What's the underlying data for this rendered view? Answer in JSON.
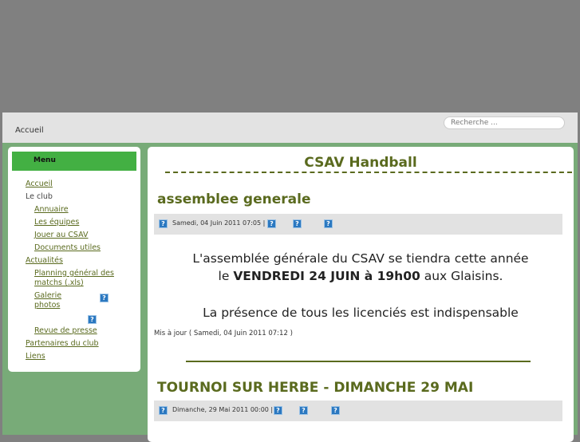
{
  "header": {
    "home": "Accueil",
    "search_placeholder": "Recherche ..."
  },
  "menu": {
    "title": "Menu",
    "items": [
      {
        "label": "Accueil"
      },
      {
        "label": "Le club"
      },
      {
        "label": "Annuaire"
      },
      {
        "label": "Les équipes"
      },
      {
        "label": "Jouer au CSAV"
      },
      {
        "label": "Documents utiles"
      },
      {
        "label": "Actualités"
      },
      {
        "label": "Planning général des matchs (.xls)"
      },
      {
        "label": "Galerie photos"
      },
      {
        "label": "Revue de presse"
      },
      {
        "label": "Partenaires du club"
      },
      {
        "label": "Liens"
      }
    ]
  },
  "main": {
    "site_title": "CSAV Handball",
    "articles": [
      {
        "title": "assemblee generale",
        "date": "Samedi, 04 Juin 2011 07:05 |",
        "line1": "L'assemblée générale du CSAV se tiendra cette année",
        "line2_pre": "le ",
        "line2_bold": "VENDREDI 24 JUIN à 19h00",
        "line2_post": " aux Glaisins.",
        "line3": "La présence de tous les licenciés est indispensable",
        "updated": "Mis à jour ( Samedi, 04 Juin 2011 07:12 )"
      },
      {
        "title": "TOURNOI SUR HERBE - DIMANCHE 29 MAI",
        "date": "Dimanche, 29 Mai 2011 00:00 |"
      }
    ]
  },
  "icon_glyph": "?"
}
